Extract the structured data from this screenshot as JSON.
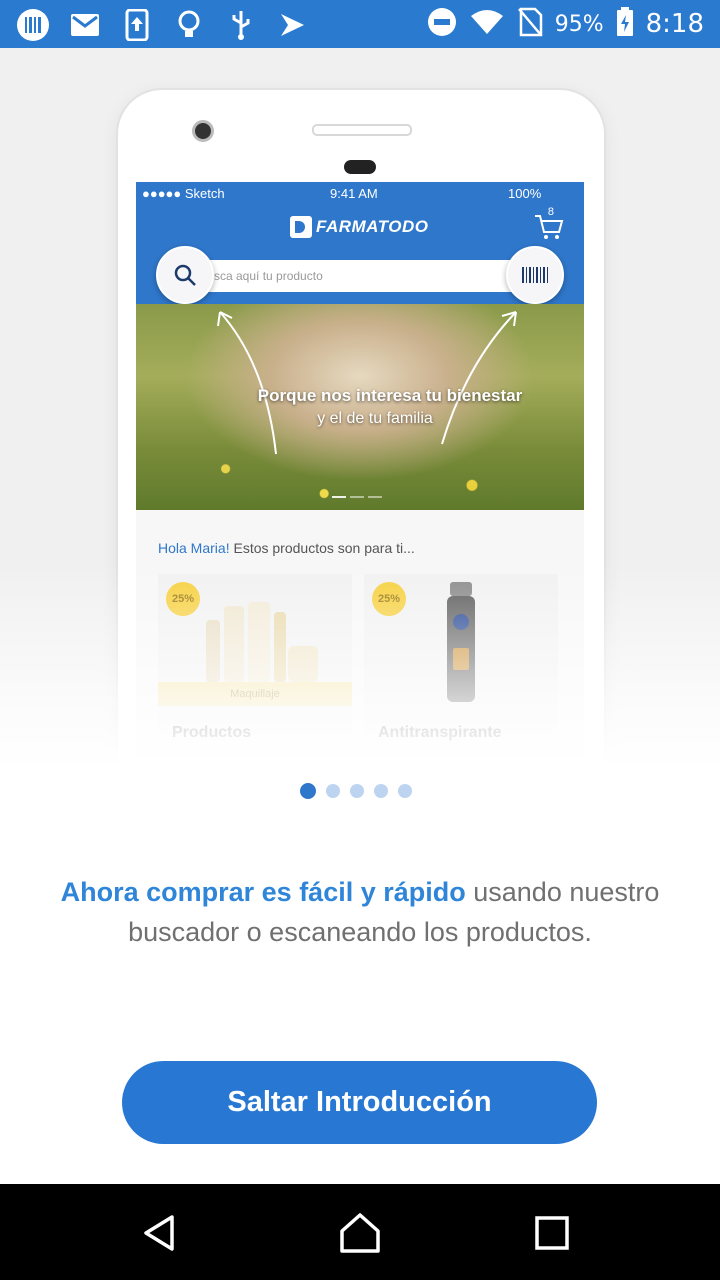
{
  "status_bar": {
    "battery": "95%",
    "time": "8:18",
    "icons": [
      "barcode-icon",
      "gmail-icon",
      "upload-icon",
      "bulb-icon",
      "usb-icon",
      "send-icon",
      "dnd-icon",
      "wifi-icon",
      "no-sim-icon",
      "battery-icon"
    ]
  },
  "phone_mockup": {
    "status": {
      "carrier": "●●●●● Sketch",
      "time": "9:41 AM",
      "battery": "100%"
    },
    "brand": "FARMATODO",
    "cart_count": "8",
    "search_placeholder": "sca aquí tu producto",
    "banner": {
      "line1": "Porque nos interesa tu bienestar",
      "line2": "y el de tu familia"
    },
    "greeting_name": "Hola Maria!",
    "greeting_rest": " Estos productos son para ti...",
    "products": [
      {
        "badge": "25%",
        "tag": "Maquillaje",
        "title": "Productos"
      },
      {
        "badge": "25%",
        "tag": "",
        "title": "Antitranspirante"
      }
    ]
  },
  "pagination": {
    "count": 5,
    "active": 0
  },
  "description": {
    "highlight": "Ahora comprar es fácil y rápido",
    "rest": " usando nuestro buscador o escaneando los productos."
  },
  "skip_button": "Saltar Introducción",
  "colors": {
    "primary": "#2877d2",
    "status_bar": "#2a7ad0",
    "highlight_text": "#2f86d9"
  }
}
